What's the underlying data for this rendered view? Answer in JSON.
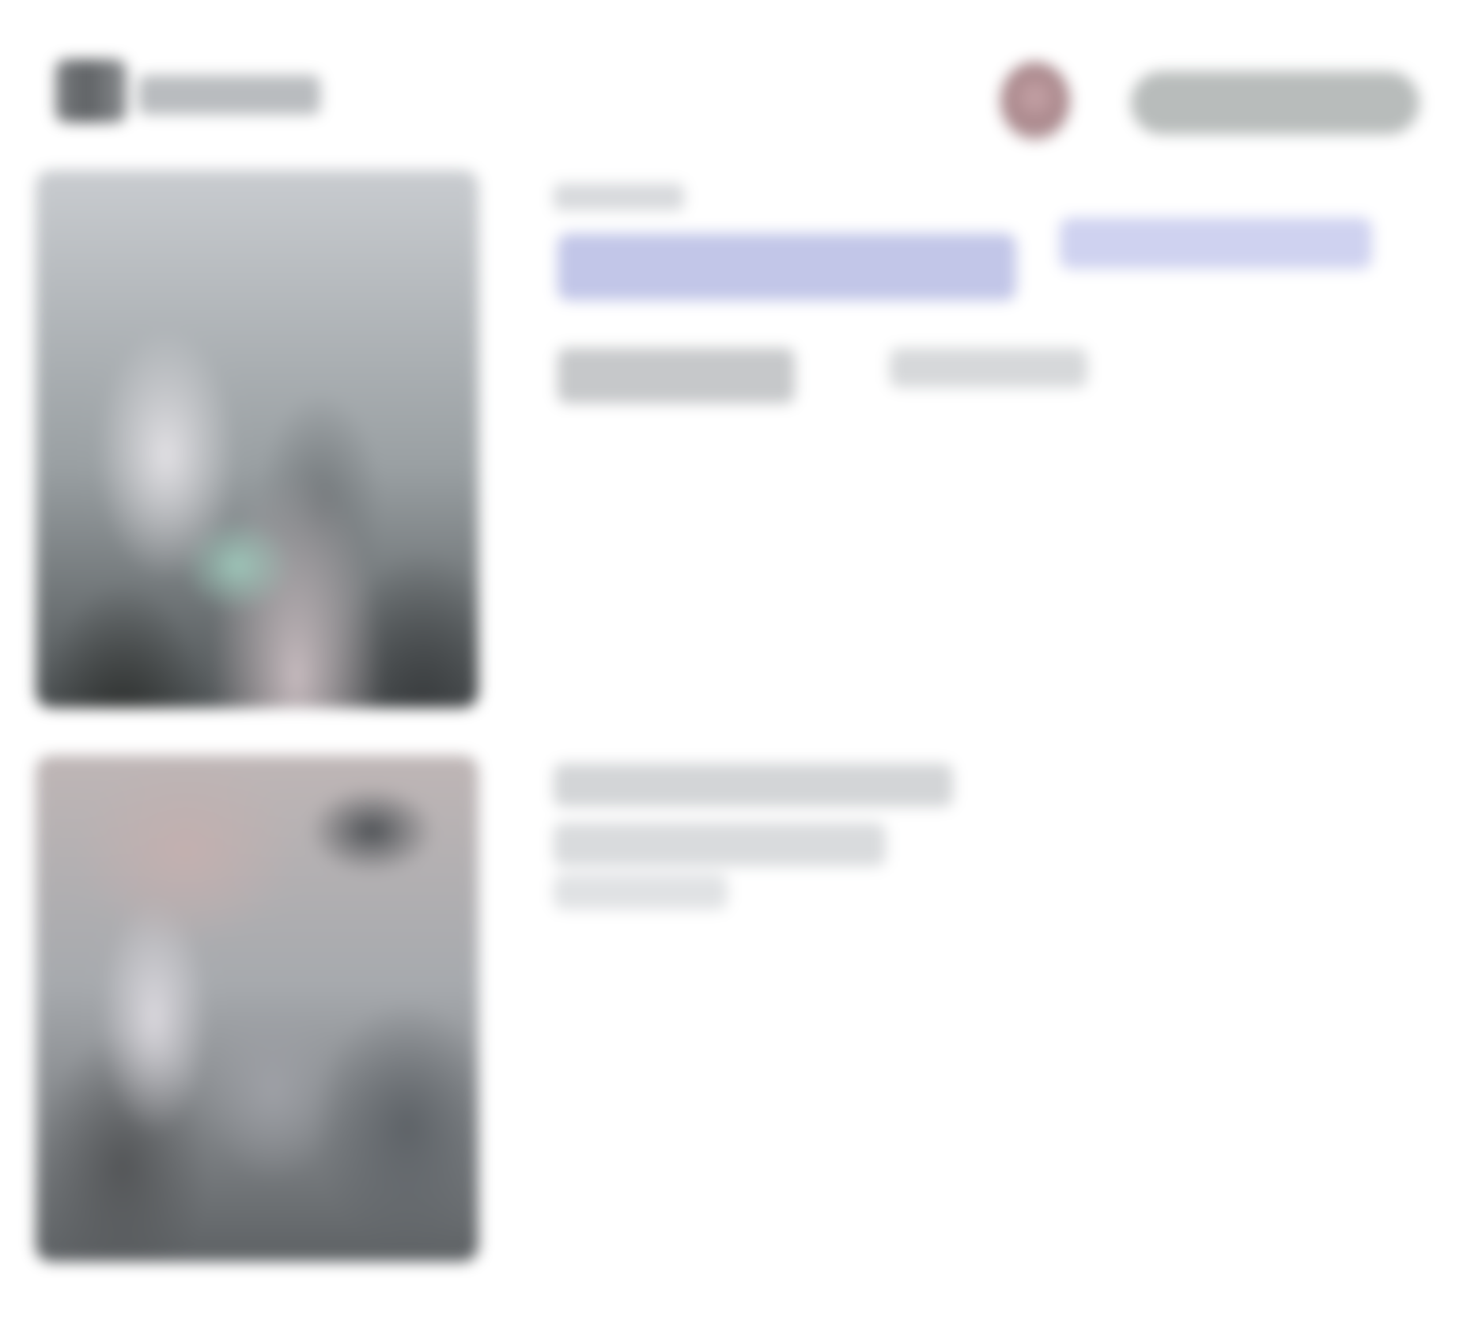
{
  "header": {
    "logo_icon": "site-logo-icon",
    "avatar_icon": "user-avatar-icon",
    "accent_button_color": "#b8bcbb"
  },
  "posts": [
    {
      "image_tone": "grey-dark"
    },
    {
      "image_tone": "pink-grey"
    }
  ],
  "colors": {
    "link_blue": "#c2c6e8",
    "text_grey": "#c6c8ca"
  }
}
